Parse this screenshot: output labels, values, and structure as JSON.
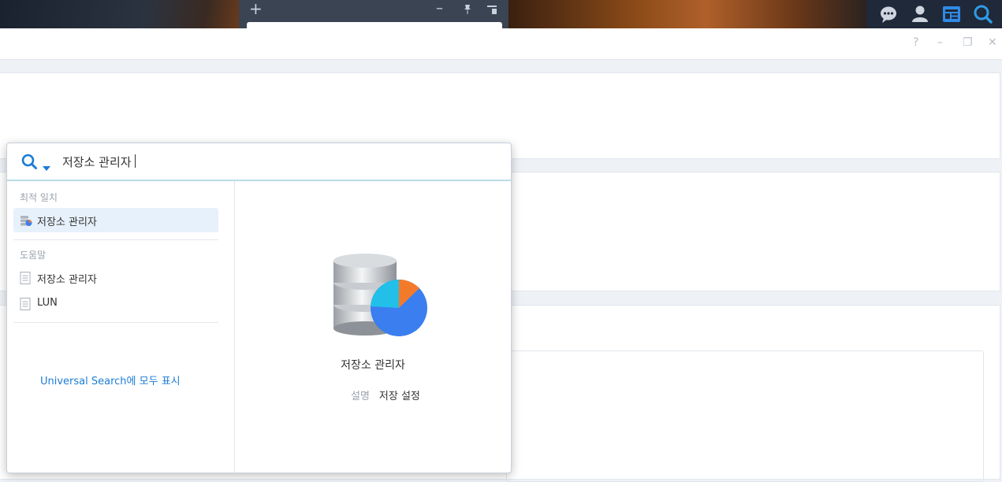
{
  "taskbar": {
    "widget_add_label": "+",
    "widget_minimize_label": "–",
    "icons": [
      "chat-icon",
      "user-icon",
      "widgets-icon",
      "search-icon"
    ]
  },
  "window": {
    "help_label": "?",
    "minimize_label": "–",
    "restore_label": "❐",
    "close_label": "✕"
  },
  "search": {
    "query": "저장소 관리자",
    "sections": {
      "best_match": "최적 일치",
      "help": "도움말"
    },
    "best_match_items": [
      {
        "label": "저장소 관리자",
        "icon": "storage-manager-icon",
        "selected": true
      }
    ],
    "help_items": [
      {
        "label": "저장소 관리자",
        "icon": "document-icon"
      },
      {
        "label": "LUN",
        "icon": "document-icon"
      }
    ],
    "show_all_link": "Universal Search에 모두 표시",
    "detail": {
      "title": "저장소 관리자",
      "desc_key": "설명",
      "desc_value": "저장 설정"
    }
  },
  "colors": {
    "accent": "#1c7cd6",
    "taskbar": "#1e2632"
  }
}
